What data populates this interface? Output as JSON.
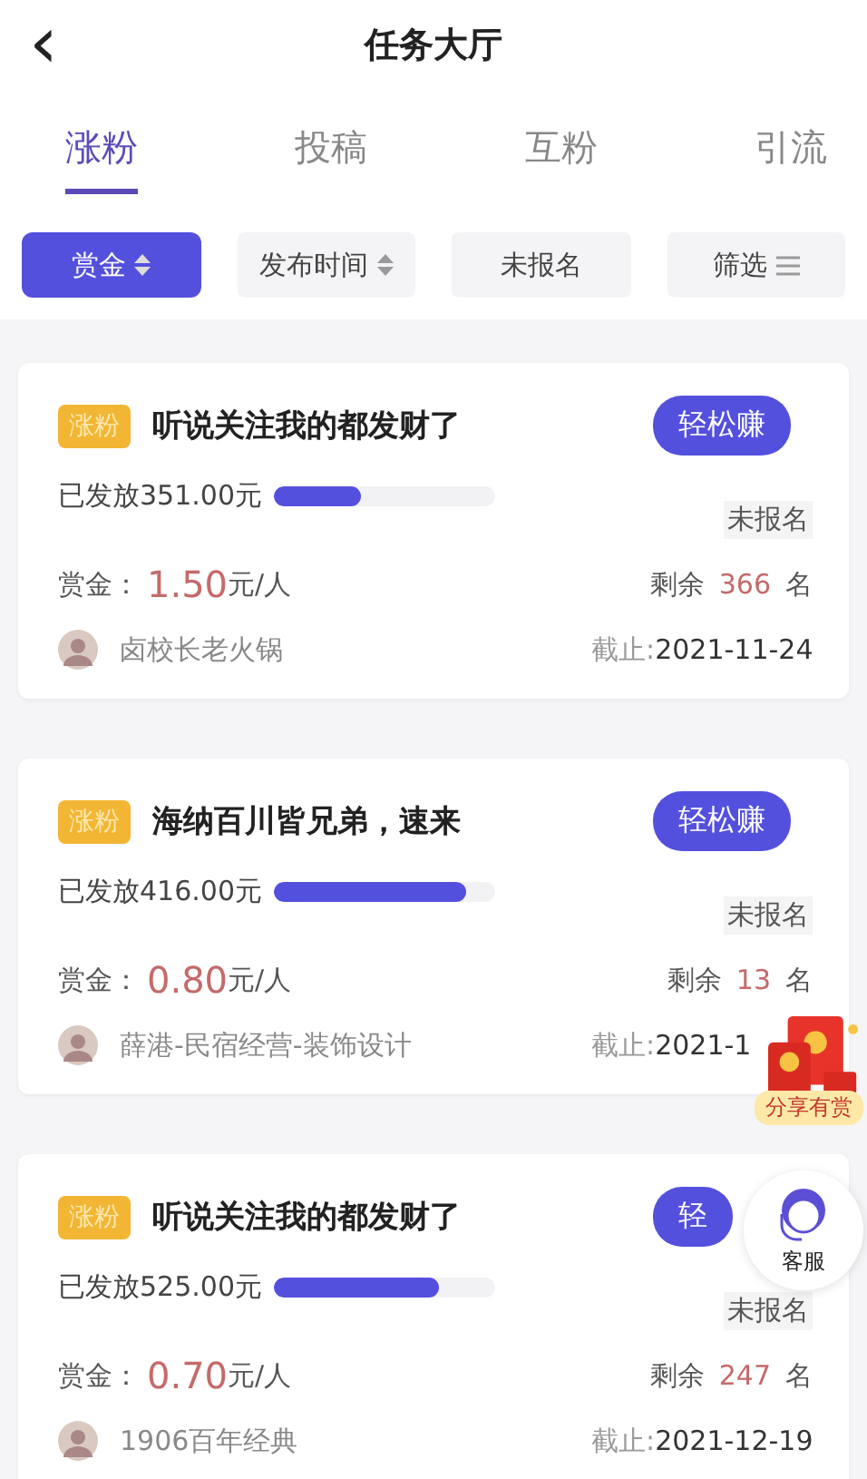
{
  "header": {
    "back": "‹",
    "title": "任务大厅"
  },
  "tabs": [
    {
      "label": "涨粉",
      "selected": true
    },
    {
      "label": "投稿",
      "selected": false
    },
    {
      "label": "互粉",
      "selected": false
    },
    {
      "label": "引流",
      "selected": false
    }
  ],
  "filters": [
    {
      "label": "赏金",
      "selected": true,
      "kind": "sort"
    },
    {
      "label": "发布时间",
      "selected": false,
      "kind": "sort"
    },
    {
      "label": "未报名",
      "selected": false,
      "kind": "plain"
    },
    {
      "label": "筛选",
      "selected": false,
      "kind": "menu"
    }
  ],
  "cards": [
    {
      "tag": "涨粉",
      "title": "听说关注我的都发财了",
      "button": "轻松赚",
      "issued": "已发放351.00元",
      "level": 0.4,
      "status": "未报名",
      "reward_label": "赏金：",
      "reward": "1.50",
      "reward_unit": "元/人",
      "remaining_label": "剩余",
      "remaining": "366",
      "remaining_unit": "名",
      "author": "卤校长老火锅",
      "deadline_label": "截止:",
      "deadline": "2021-11-24"
    },
    {
      "tag": "涨粉",
      "title": "海纳百川皆兄弟，速来",
      "button": "轻松赚",
      "issued": "已发放416.00元",
      "level": 0.87,
      "status": "未报名",
      "reward_label": "赏金：",
      "reward": "0.80",
      "reward_unit": "元/人",
      "remaining_label": "剩余",
      "remaining": "13",
      "remaining_unit": "名",
      "author": "薛港-民宿经营-装饰设计",
      "deadline_label": "截止:",
      "deadline": "2021-1"
    },
    {
      "tag": "涨粉",
      "title": "听说关注我的都发财了",
      "button": "轻",
      "issued": "已发放525.00元",
      "level": 0.75,
      "status": "未报名",
      "reward_label": "赏金：",
      "reward": "0.70",
      "reward_unit": "元/人",
      "remaining_label": "剩余",
      "remaining": "247",
      "remaining_unit": "名",
      "author": "1906百年经典",
      "deadline_label": "截止:",
      "deadline": "2021-12-19"
    }
  ],
  "share_badge": {
    "label": "分享有赏"
  },
  "service_button": {
    "label": "客服"
  }
}
